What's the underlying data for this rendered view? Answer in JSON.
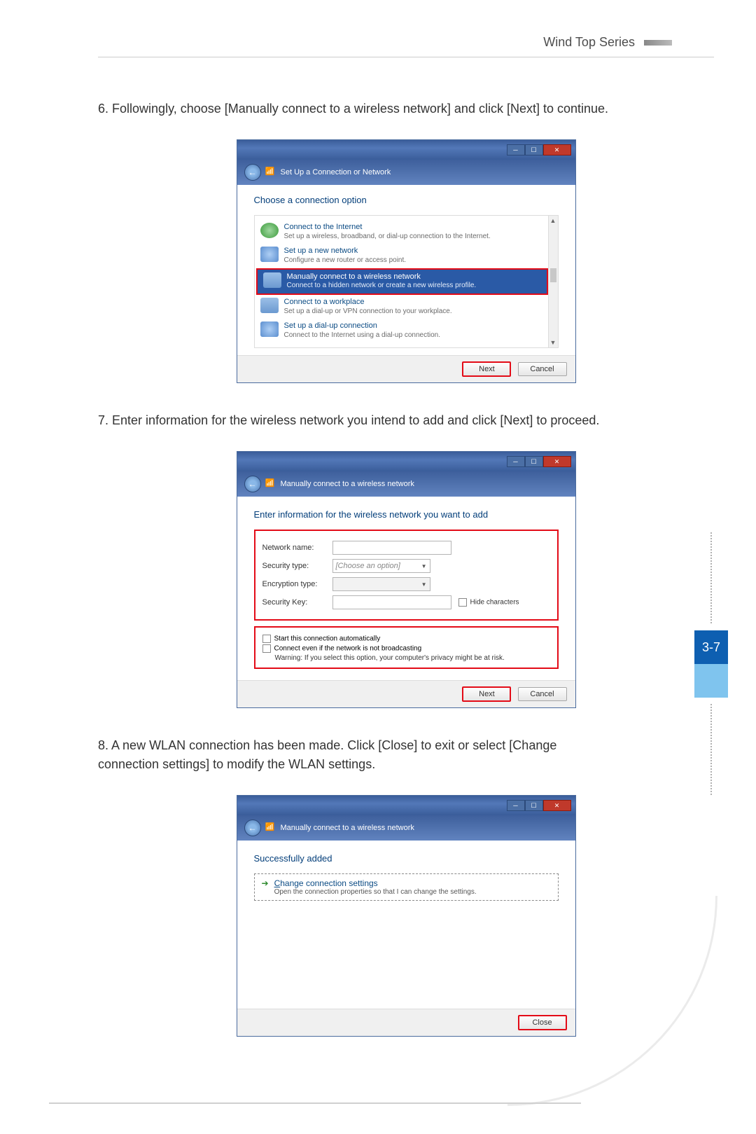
{
  "header": {
    "series": "Wind Top Series"
  },
  "page_tab": "3-7",
  "steps": {
    "s6": {
      "num": "6.",
      "text": "Followingly, choose [Manually connect to a wireless network] and click [Next] to continue."
    },
    "s7": {
      "num": "7.",
      "text": "Enter information for the wireless network you intend to add and click [Next] to proceed."
    },
    "s8": {
      "num": "8.",
      "text": "A new WLAN connection has been made. Click [Close] to exit or select [Change connection settings] to modify the WLAN settings."
    }
  },
  "dlg1": {
    "title": "Set Up a Connection or Network",
    "instruction": "Choose a connection option",
    "options": [
      {
        "title": "Connect to the Internet",
        "desc": "Set up a wireless, broadband, or dial-up connection to the Internet."
      },
      {
        "title": "Set up a new network",
        "desc": "Configure a new router or access point."
      },
      {
        "title": "Manually connect to a wireless network",
        "desc": "Connect to a hidden network or create a new wireless profile."
      },
      {
        "title": "Connect to a workplace",
        "desc": "Set up a dial-up or VPN connection to your workplace."
      },
      {
        "title": "Set up a dial-up connection",
        "desc": "Connect to the Internet using a dial-up connection."
      }
    ],
    "next": "Next",
    "cancel": "Cancel"
  },
  "dlg2": {
    "title": "Manually connect to a wireless network",
    "instruction": "Enter information for the wireless network you want to add",
    "fields": {
      "network_name": {
        "label": "Network name:"
      },
      "security_type": {
        "label": "Security type:",
        "placeholder": "[Choose an option]"
      },
      "encryption_type": {
        "label": "Encryption type:"
      },
      "security_key": {
        "label": "Security Key:"
      },
      "hide_characters": "Hide characters"
    },
    "checks": {
      "auto": "Start this connection automatically",
      "hidden": "Connect even if the network is not broadcasting",
      "warning": "Warning: If you select this option, your computer's privacy might be at risk."
    },
    "next": "Next",
    "cancel": "Cancel"
  },
  "dlg3": {
    "title": "Manually connect to a wireless network",
    "instruction": "Successfully added",
    "link_title_pre": "C",
    "link_title_rest": "hange connection settings",
    "link_desc": "Open the connection properties so that I can change the settings.",
    "close": "Close"
  }
}
